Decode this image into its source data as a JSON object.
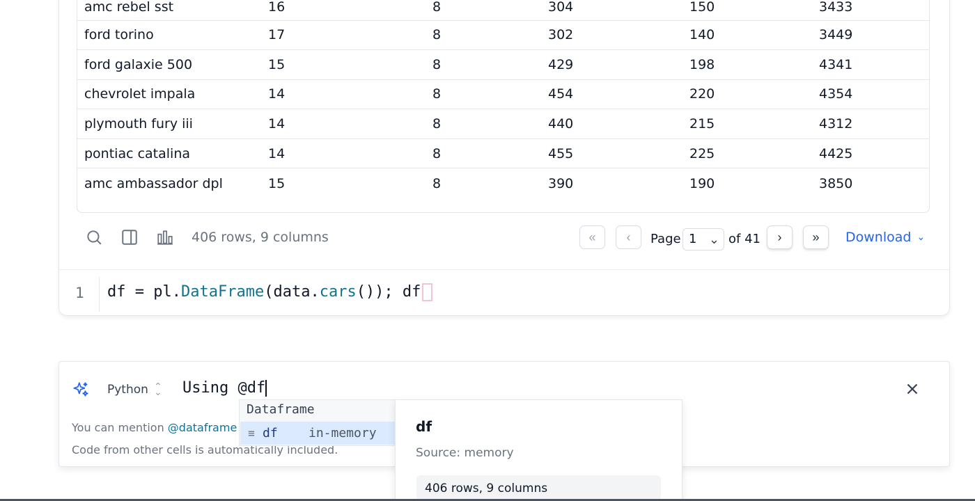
{
  "table": {
    "rows": [
      [
        "amc rebel sst",
        "16",
        "8",
        "304",
        "150",
        "3433"
      ],
      [
        "ford torino",
        "17",
        "8",
        "302",
        "140",
        "3449"
      ],
      [
        "ford galaxie 500",
        "15",
        "8",
        "429",
        "198",
        "4341"
      ],
      [
        "chevrolet impala",
        "14",
        "8",
        "454",
        "220",
        "4354"
      ],
      [
        "plymouth fury iii",
        "14",
        "8",
        "440",
        "215",
        "4312"
      ],
      [
        "pontiac catalina",
        "14",
        "8",
        "455",
        "225",
        "4425"
      ],
      [
        "amc ambassador dpl",
        "15",
        "8",
        "390",
        "190",
        "3850"
      ]
    ]
  },
  "footer": {
    "row_count": "406 rows, 9 columns",
    "page_label": "Page",
    "page_value": "1",
    "page_of": "of 41",
    "download_label": "Download",
    "icons": [
      "search-icon",
      "columns-icon",
      "chart-icon"
    ]
  },
  "code": {
    "line_number": "1",
    "var": "df",
    "eq": " = ",
    "mod": "pl",
    "dot1": ".",
    "cls": "DataFrame",
    "open": "(",
    "arg_obj": "data",
    "dot2": ".",
    "arg_fn": "cars",
    "close": "()); ",
    "tail": "df"
  },
  "ai": {
    "language": "Python",
    "prompt_text": "Using @df",
    "hint_prefix": "You can mention ",
    "hint_mention": "@dataframe",
    "hint_line2": "Code from other cells is automatically included."
  },
  "autocomplete": {
    "header": "Dataframe",
    "item_name": "df",
    "item_tag": "in-memory"
  },
  "detail": {
    "title": "df",
    "source": "Source: memory",
    "summary": "406 rows, 9 columns"
  },
  "colors": {
    "accent": "#2563eb",
    "code_fn": "#0e7490",
    "selected": "#dbeafe"
  }
}
